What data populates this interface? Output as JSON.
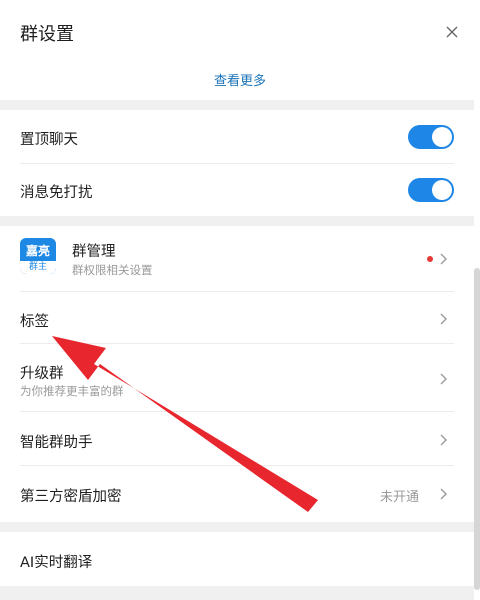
{
  "header": {
    "title": "群设置",
    "see_more": "查看更多"
  },
  "pin_chat": {
    "label": "置顶聊天",
    "enabled": true
  },
  "mute": {
    "label": "消息免打扰",
    "enabled": true
  },
  "group_mgmt": {
    "avatar_top": "嘉亮",
    "avatar_role": "群主",
    "label": "群管理",
    "sub": "群权限相关设置",
    "badge_color": "#e53935"
  },
  "tags": {
    "label": "标签"
  },
  "upgrade": {
    "label": "升级群",
    "sub": "为你推荐更丰富的群"
  },
  "assistant": {
    "label": "智能群助手"
  },
  "encryption": {
    "label": "第三方密盾加密",
    "value": "未开通"
  },
  "translate": {
    "label": "AI实时翻译"
  },
  "colors": {
    "accent": "#1d86e6",
    "link": "#1a73b8",
    "arrow": "#e8262d"
  }
}
